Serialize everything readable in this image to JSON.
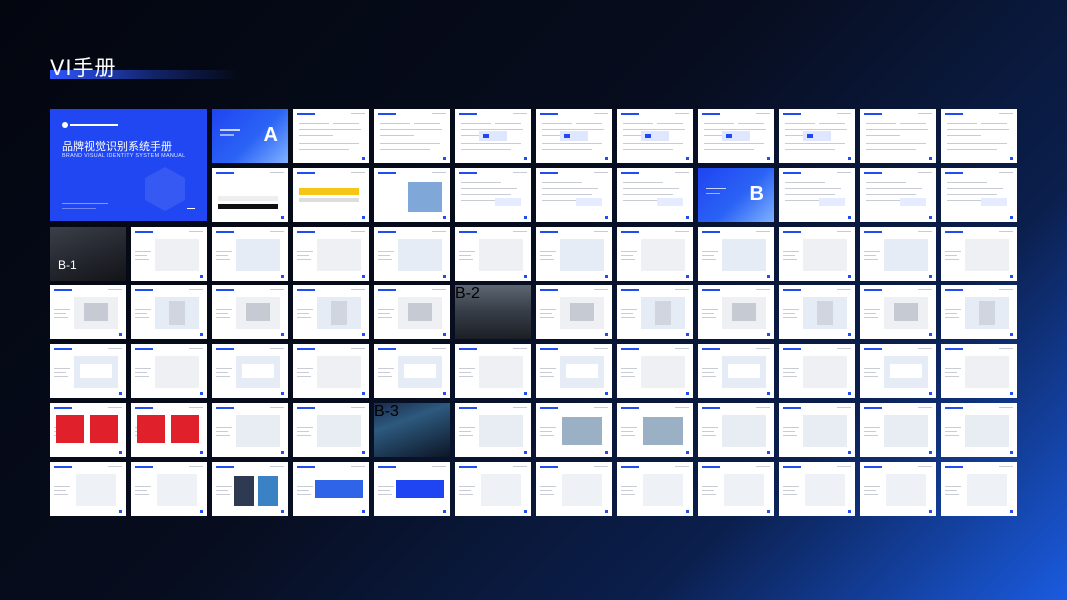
{
  "page": {
    "title": "VI手册"
  },
  "cover": {
    "title": "品牌视觉识别系统手册",
    "subtitle": "BRAND VISUAL IDENTITY SYSTEM MANUAL"
  },
  "sections": {
    "a": "A",
    "b": "B"
  },
  "photo_labels": {
    "b1": "B-1",
    "b2": "B-2",
    "b3": "B-3"
  },
  "colors": {
    "accent": "#2147f2",
    "yellow": "#f5c518",
    "red": "#e0202a"
  }
}
